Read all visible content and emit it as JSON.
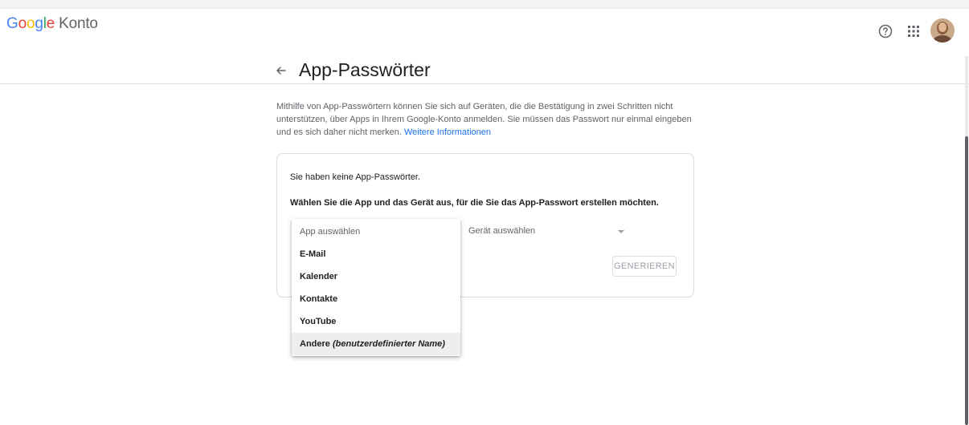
{
  "header": {
    "logo_letters": [
      "G",
      "o",
      "o",
      "g",
      "l",
      "e"
    ],
    "product": "Konto",
    "icons": [
      "help-icon",
      "apps-grid-icon",
      "avatar"
    ]
  },
  "page": {
    "title": "App-Passwörter",
    "intro_text": "Mithilfe von App-Passwörtern können Sie sich auf Geräten, die die Bestätigung in zwei Schritten nicht unterstützen, über Apps in Ihrem Google-Konto anmelden. Sie müssen das Passwort nur einmal eingeben und es sich daher nicht merken.",
    "learn_more": "Weitere Informationen"
  },
  "card": {
    "no_passwords": "Sie haben keine App-Passwörter.",
    "choose_text": "Wählen Sie die App und das Gerät aus, für die Sie das App-Passwort erstellen möchten.",
    "device_select": "Gerät auswählen",
    "generate_button": "GENERIEREN"
  },
  "dropdown": {
    "placeholder": "App auswählen",
    "items": [
      "E-Mail",
      "Kalender",
      "Kontakte",
      "YouTube"
    ],
    "other_label": "Andere",
    "other_hint": "(benutzerdefinierter Name)",
    "highlighted": "Andere"
  },
  "colors": {
    "link": "#1a73e8",
    "text": "#202124",
    "muted": "#5f6368",
    "border": "#dadce0",
    "highlight": "#eeeeee"
  }
}
